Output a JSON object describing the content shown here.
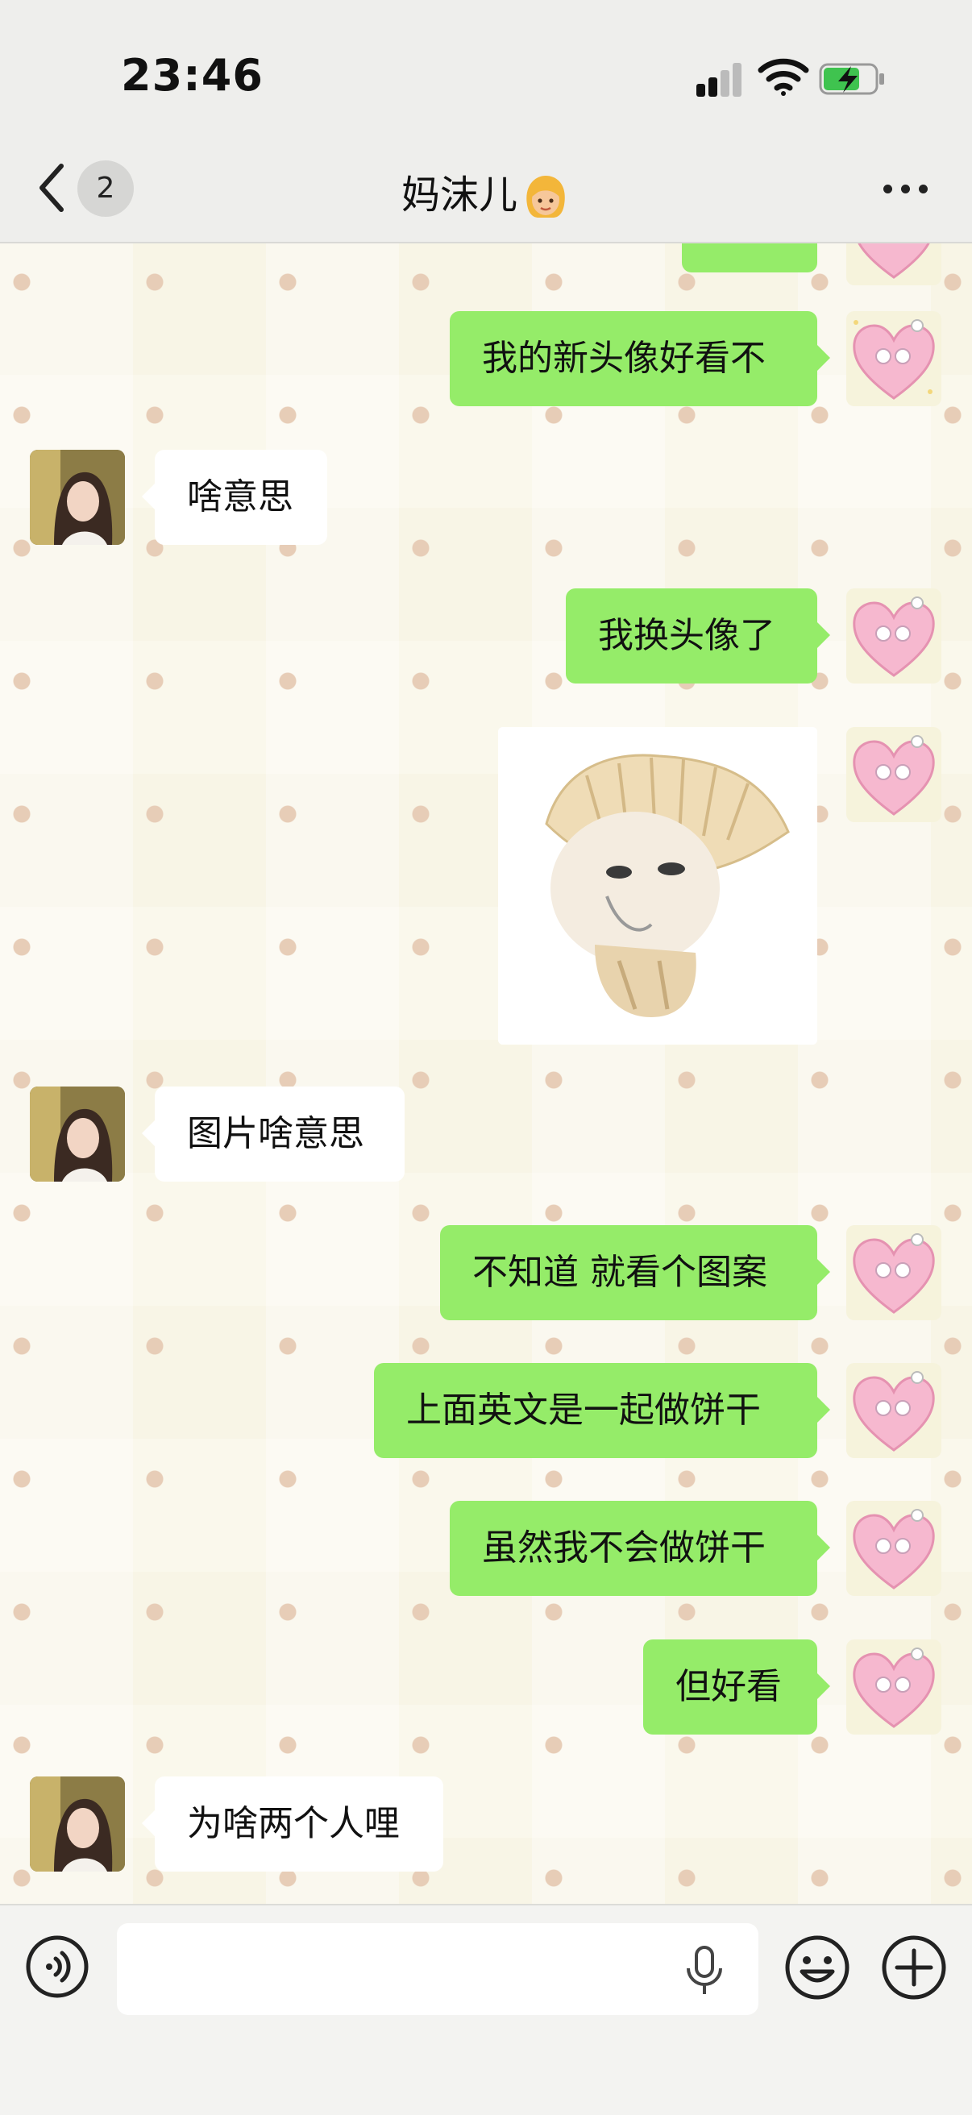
{
  "status_bar": {
    "time": "23:46"
  },
  "header": {
    "unread_count": "2",
    "contact_name": "妈沫儿",
    "contact_emoji": "woman-emoji"
  },
  "messages": [
    {
      "from": "me",
      "type": "text",
      "text": "我的新头像好看不"
    },
    {
      "from": "them",
      "type": "text",
      "text": "啥意思"
    },
    {
      "from": "me",
      "type": "text",
      "text": "我换头像了"
    },
    {
      "from": "me",
      "type": "image",
      "image": "dumpling-meme-sticker"
    },
    {
      "from": "them",
      "type": "text",
      "text": "图片啥意思"
    },
    {
      "from": "me",
      "type": "text",
      "text": "不知道 就看个图案"
    },
    {
      "from": "me",
      "type": "text",
      "text": "上面英文是一起做饼干"
    },
    {
      "from": "me",
      "type": "text",
      "text": "虽然我不会做饼干"
    },
    {
      "from": "me",
      "type": "text",
      "text": "但好看"
    },
    {
      "from": "them",
      "type": "text",
      "text": "为啥两个人哩"
    }
  ],
  "input_bar": {
    "voice_icon": "voice-mode-icon",
    "microphone_icon": "microphone-icon",
    "emoji_icon": "smiley-icon",
    "plus_icon": "plus-circle-icon"
  },
  "colors": {
    "my_bubble": "#95ec69",
    "their_bubble": "#ffffff",
    "chat_background": "#f8f5e6",
    "header_background": "#eeeeec"
  }
}
